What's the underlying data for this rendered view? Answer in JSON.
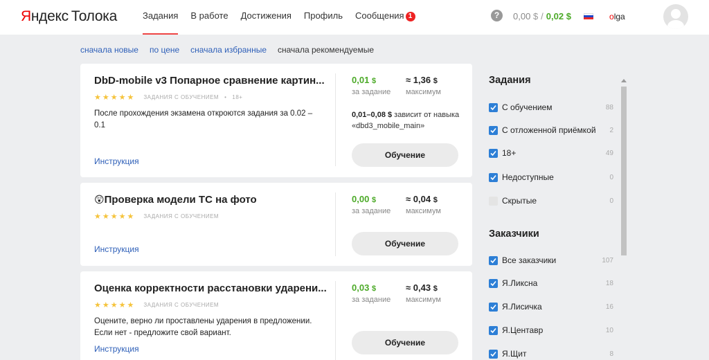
{
  "header": {
    "logo_first": "Я",
    "logo_rest": "ндекс",
    "logo_product": "Толока",
    "nav": [
      {
        "label": "Задания",
        "active": true
      },
      {
        "label": "В работе"
      },
      {
        "label": "Достижения"
      },
      {
        "label": "Профиль"
      },
      {
        "label": "Сообщения",
        "badge": "1"
      }
    ],
    "help_glyph": "?",
    "balance": {
      "value": "0,00",
      "currency": "$",
      "separator": "/",
      "earned": "0,02"
    },
    "user_first": "o",
    "user_rest": "lga",
    "flag_colors": [
      "#ffffff",
      "#2046c8",
      "#e82a2a"
    ]
  },
  "sort": [
    {
      "label": "сначала новые"
    },
    {
      "label": "по цене"
    },
    {
      "label": "сначала избранные"
    },
    {
      "label": "сначала рекомендуемые",
      "current": true
    }
  ],
  "cards": [
    {
      "title": "DbD-mobile v3 Попарное сравнение картин...",
      "stars": "★★★★★",
      "meta": "ЗАДАНИЯ С ОБУЧЕНИЕМ",
      "meta_dot": "•",
      "meta_extra": "18+",
      "description": "После прохождения экзамена откроются задания за 0.02 – 0.1",
      "instruction": "Инструкция",
      "price": "0,01",
      "price_label": "за задание",
      "max": "≈ 1,36",
      "max_label": "максимум",
      "range_bold": "0,01–0,08 $",
      "range_text": " зависит от навыка «dbd3_mobile_main»",
      "button": "Обучение"
    },
    {
      "emoji": "😲",
      "title": "Проверка модели ТС на фото",
      "stars": "★★★★★",
      "meta": "ЗАДАНИЯ С ОБУЧЕНИЕМ",
      "instruction": "Инструкция",
      "price": "0,00",
      "price_label": "за задание",
      "max": "≈ 0,04",
      "max_label": "максимум",
      "button": "Обучение"
    },
    {
      "title": "Оценка корректности расстановки ударени...",
      "stars": "★★★★★",
      "meta": "ЗАДАНИЯ С ОБУЧЕНИЕМ",
      "description": "Оцените, верно ли проставлены ударения в предложении. Если нет - предложите свой вариант.",
      "instruction": "Инструкция",
      "price": "0,03",
      "price_label": "за задание",
      "max": "≈ 0,43",
      "max_label": "максимум",
      "button": "Обучение"
    }
  ],
  "currency": "$",
  "sidebar": {
    "tasks_title": "Задания",
    "tasks": [
      {
        "label": "С обучением",
        "count": "88",
        "checked": true
      },
      {
        "label": "С отложенной приёмкой",
        "count": "2",
        "checked": true
      },
      {
        "label": "18+",
        "count": "49",
        "checked": true
      },
      {
        "label": "Недоступные",
        "count": "0",
        "checked": true
      },
      {
        "label": "Скрытые",
        "count": "0",
        "checked": false
      }
    ],
    "clients_title": "Заказчики",
    "clients": [
      {
        "label": "Все заказчики",
        "count": "107",
        "checked": true
      },
      {
        "label": "Я.Ликсна",
        "count": "18",
        "checked": true
      },
      {
        "label": "Я.Лисичка",
        "count": "16",
        "checked": true
      },
      {
        "label": "Я.Центавр",
        "count": "10",
        "checked": true
      },
      {
        "label": "Я.Щит",
        "count": "8",
        "checked": true
      }
    ]
  }
}
